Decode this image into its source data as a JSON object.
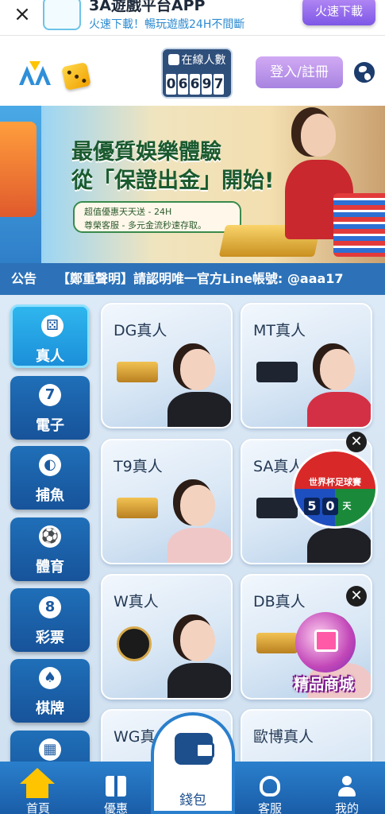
{
  "download_banner": {
    "title": "3A遊戲平台APP",
    "subtitle": "火速下載！暢玩遊戲24H不間斷",
    "button_label": "火速下載"
  },
  "header": {
    "online_label": "在線人數",
    "online_digits": [
      "0",
      "6",
      "6",
      "9",
      "7"
    ],
    "login_label": "登入/註冊"
  },
  "promo": {
    "title_line1": "最優質娛樂體驗",
    "title_line2": "從「保證出金」開始!",
    "pill_line1": "超值優惠天天送 - 24H",
    "pill_line2": "尊榮客服 - 多元金流秒速存取。"
  },
  "notice": {
    "label": "公告",
    "text": "【鄭重聲明】請認明唯一官方Line帳號: @aaa17"
  },
  "categories": [
    {
      "label": "真人",
      "icon": "dice-icon"
    },
    {
      "label": "電子",
      "icon": "seven-icon"
    },
    {
      "label": "捕魚",
      "icon": "fish-icon"
    },
    {
      "label": "體育",
      "icon": "soccer-icon"
    },
    {
      "label": "彩票",
      "icon": "lottery-ball-icon"
    },
    {
      "label": "棋牌",
      "icon": "spade-icon"
    },
    {
      "label": "",
      "icon": "shop-icon"
    }
  ],
  "games": [
    {
      "title": "DG真人"
    },
    {
      "title": "MT真人"
    },
    {
      "title": "T9真人"
    },
    {
      "title": "SA真人"
    },
    {
      "title": "W真人"
    },
    {
      "title": "DB真人"
    },
    {
      "title": "WG真人"
    },
    {
      "title": "歐博真人"
    }
  ],
  "world_cup": {
    "title": "世界杯足球賽",
    "days": [
      "5",
      "0"
    ],
    "unit": "天"
  },
  "mall": {
    "label": "精品商城"
  },
  "bottom_nav": {
    "home": "首頁",
    "promo": "優惠",
    "wallet": "錢包",
    "service": "客服",
    "mine": "我的"
  },
  "colors": {
    "nav_blue": "#1a5da8",
    "notice_blue": "#2d72b8",
    "login_purple": "#a784e0",
    "active_category": "#1b8fd9"
  }
}
